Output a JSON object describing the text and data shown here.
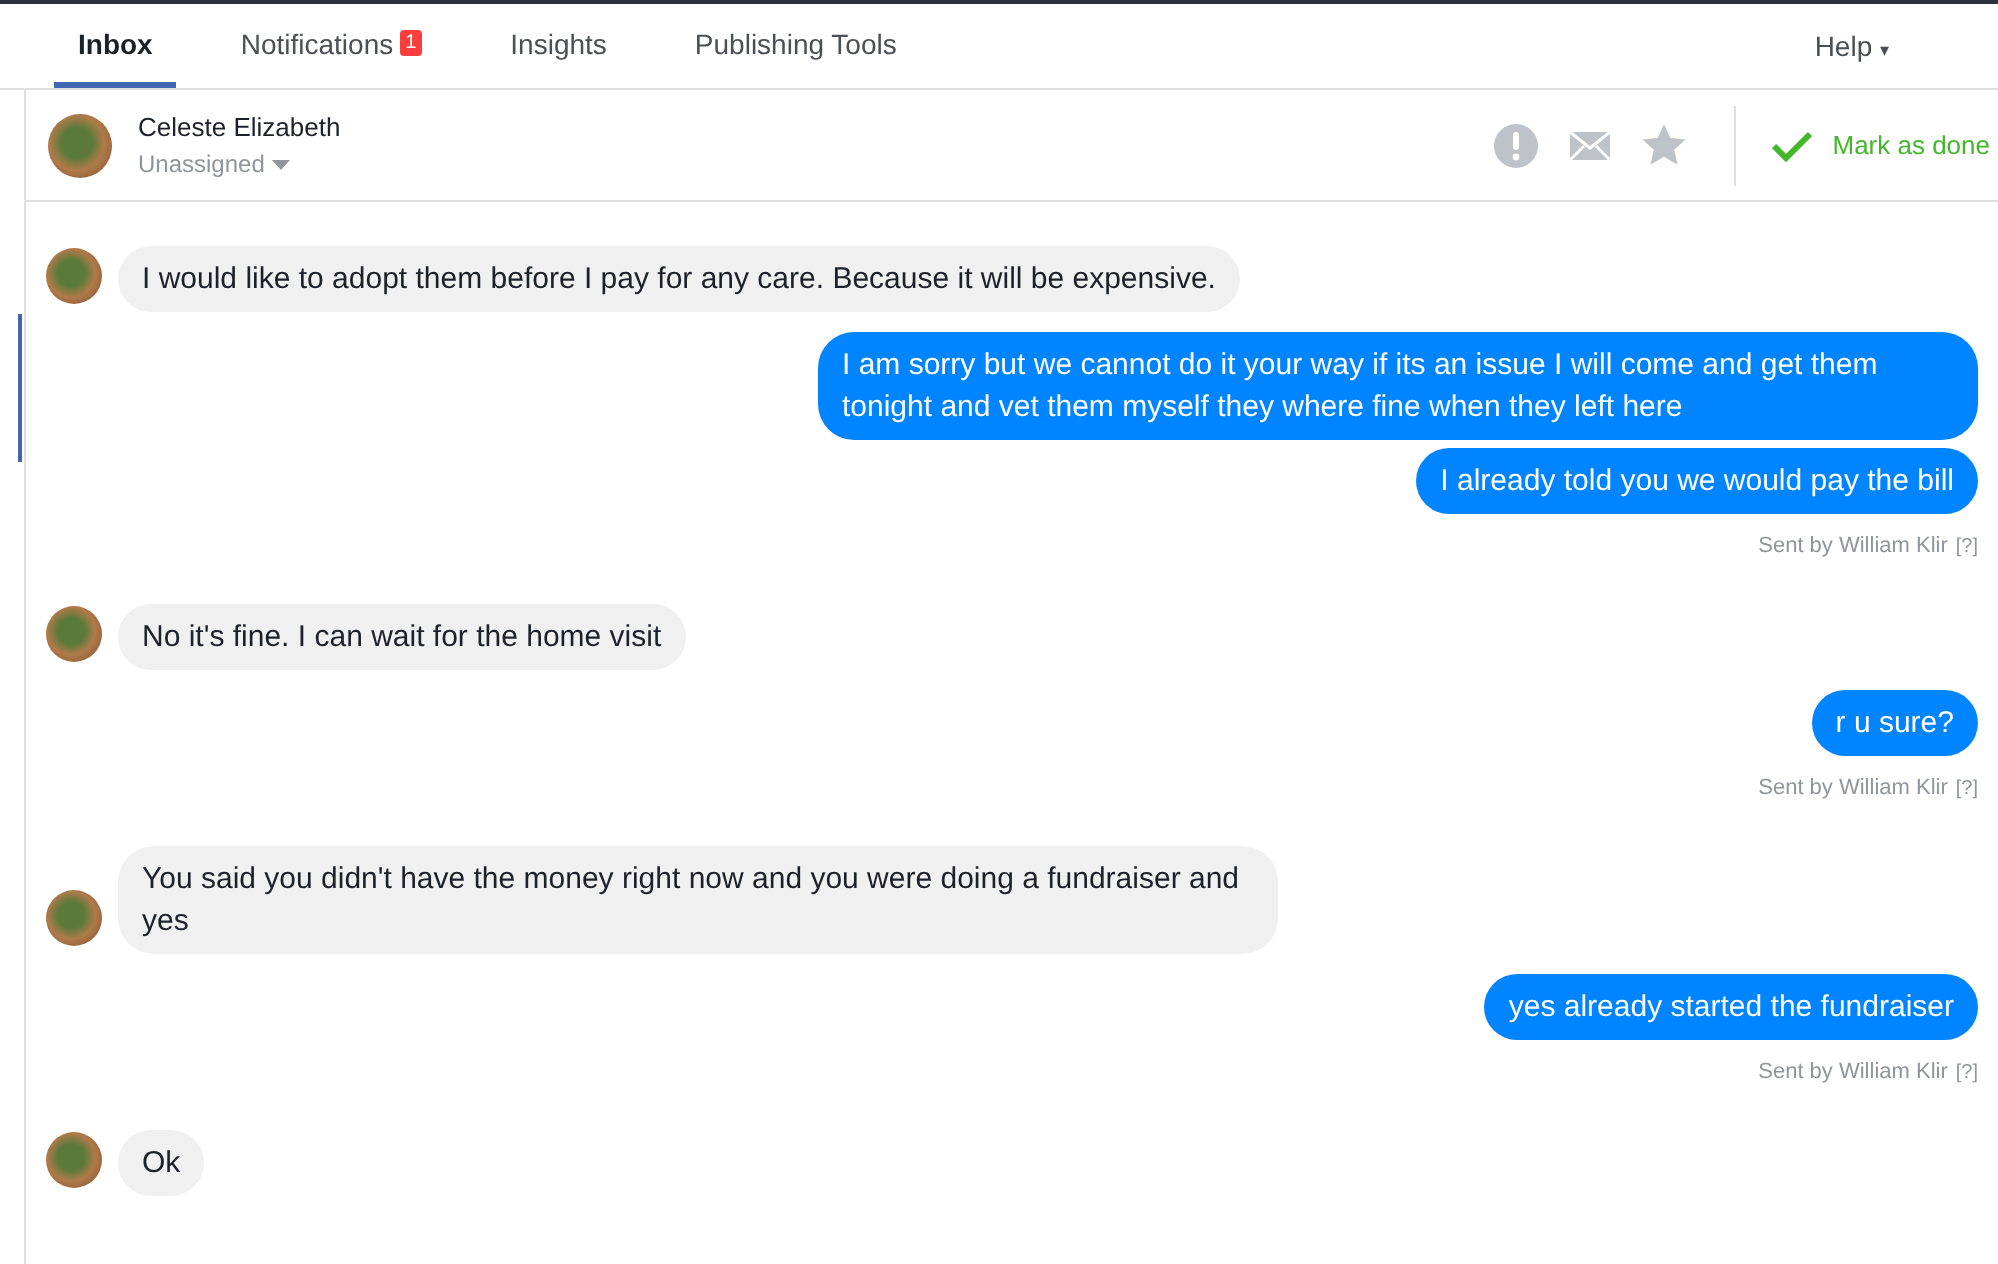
{
  "tabs": [
    {
      "label": "Inbox",
      "selected": true
    },
    {
      "label": "Notifications",
      "selected": false,
      "badge": "1"
    },
    {
      "label": "Insights",
      "selected": false
    },
    {
      "label": "Publishing Tools",
      "selected": false
    }
  ],
  "help": {
    "label": "Help",
    "caret": "▾"
  },
  "conversation": {
    "name": "Celeste Elizabeth",
    "assignee": "Unassigned",
    "mark_done": "Mark as done"
  },
  "messages": [
    {
      "kind": "incoming",
      "text": "I would like to adopt them before I pay for any care. Because it will be expensive."
    },
    {
      "kind": "outgoing",
      "text": "I am sorry but we cannot do it your way if its an issue I will come and get them tonight and vet them myself they where fine when they left here"
    },
    {
      "kind": "outgoing",
      "text": "I already told you we would pay the bill",
      "sent_by": "Sent by William Klir",
      "help": "[?]"
    },
    {
      "kind": "incoming",
      "text": "No it's fine. I can wait for the home visit"
    },
    {
      "kind": "outgoing",
      "text": "r u sure?",
      "sent_by": "Sent by William Klir",
      "help": "[?]"
    },
    {
      "kind": "incoming",
      "text": "You said you didn't have the money right now and you were doing a fundraiser and yes"
    },
    {
      "kind": "outgoing",
      "text": "yes already started the fundraiser",
      "sent_by": "Sent by William Klir",
      "help": "[?]"
    },
    {
      "kind": "incoming",
      "text": "Ok"
    }
  ]
}
